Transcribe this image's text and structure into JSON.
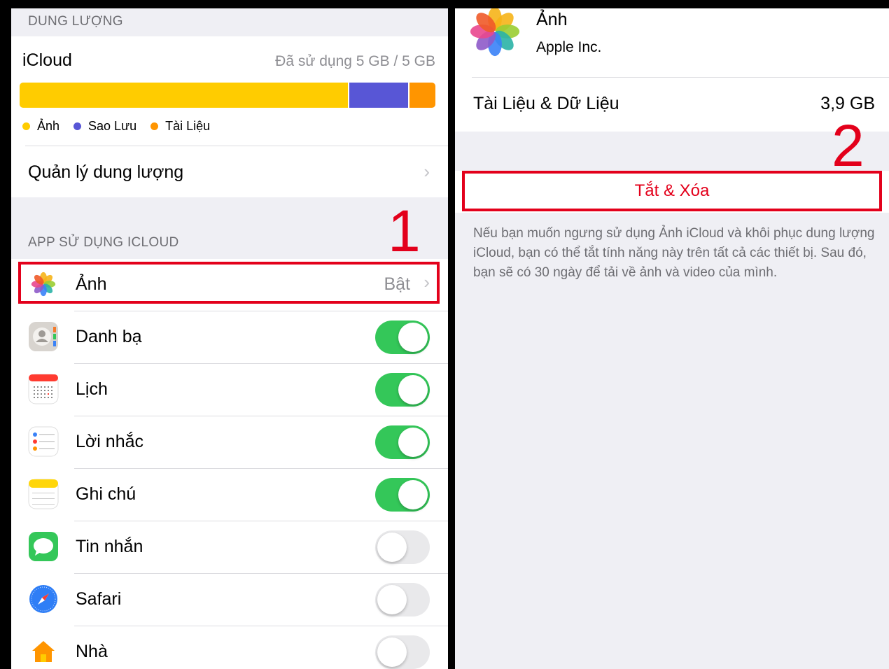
{
  "left": {
    "storage_section_header": "DUNG LƯỢNG",
    "icloud": {
      "title": "iCloud",
      "usage": "Đã sử dụng 5 GB / 5 GB",
      "bar_segments": [
        {
          "name": "Ảnh",
          "fraction": 0.79,
          "color": "#ffcc00"
        },
        {
          "name": "Sao Lưu",
          "fraction": 0.145,
          "color": "#5856d6"
        },
        {
          "name": "Tài Liệu",
          "fraction": 0.065,
          "color": "#ff9500"
        }
      ],
      "legend": [
        {
          "label": "Ảnh",
          "color": "#ffcc00"
        },
        {
          "label": "Sao Lưu",
          "color": "#5856d6"
        },
        {
          "label": "Tài Liệu",
          "color": "#ff9500"
        }
      ]
    },
    "manage_storage_label": "Quản lý dung lượng",
    "apps_section_header": "APP SỬ DỤNG ICLOUD",
    "apps": [
      {
        "label": "Ảnh",
        "icon": "photos-icon",
        "status": "Bật"
      },
      {
        "label": "Danh bạ",
        "icon": "contacts-icon",
        "toggle": true
      },
      {
        "label": "Lịch",
        "icon": "calendar-icon",
        "toggle": true
      },
      {
        "label": "Lời nhắc",
        "icon": "reminders-icon",
        "toggle": true
      },
      {
        "label": "Ghi chú",
        "icon": "notes-icon",
        "toggle": true
      },
      {
        "label": "Tin nhắn",
        "icon": "messages-icon",
        "toggle": false
      },
      {
        "label": "Safari",
        "icon": "safari-icon",
        "toggle": false
      },
      {
        "label": "Nhà",
        "icon": "home-icon",
        "toggle": false
      }
    ],
    "step_marker": "1"
  },
  "right": {
    "app_name": "Ảnh",
    "developer": "Apple Inc.",
    "docs_label": "Tài Liệu & Dữ Liệu",
    "docs_value": "3,9 GB",
    "turn_off_button": "Tắt & Xóa",
    "info_text": "Nếu bạn muốn ngưng sử dụng Ảnh iCloud và khôi phục dung lượng iCloud, bạn có thể tắt tính năng này trên tất cả các thiết bị. Sau đó, bạn sẽ có 30 ngày để tải về ảnh và video của mình.",
    "step_marker": "2"
  },
  "colors": {
    "accent_red": "#e3001b",
    "toggle_on": "#34c759",
    "toggle_off": "#e9e9eb"
  }
}
